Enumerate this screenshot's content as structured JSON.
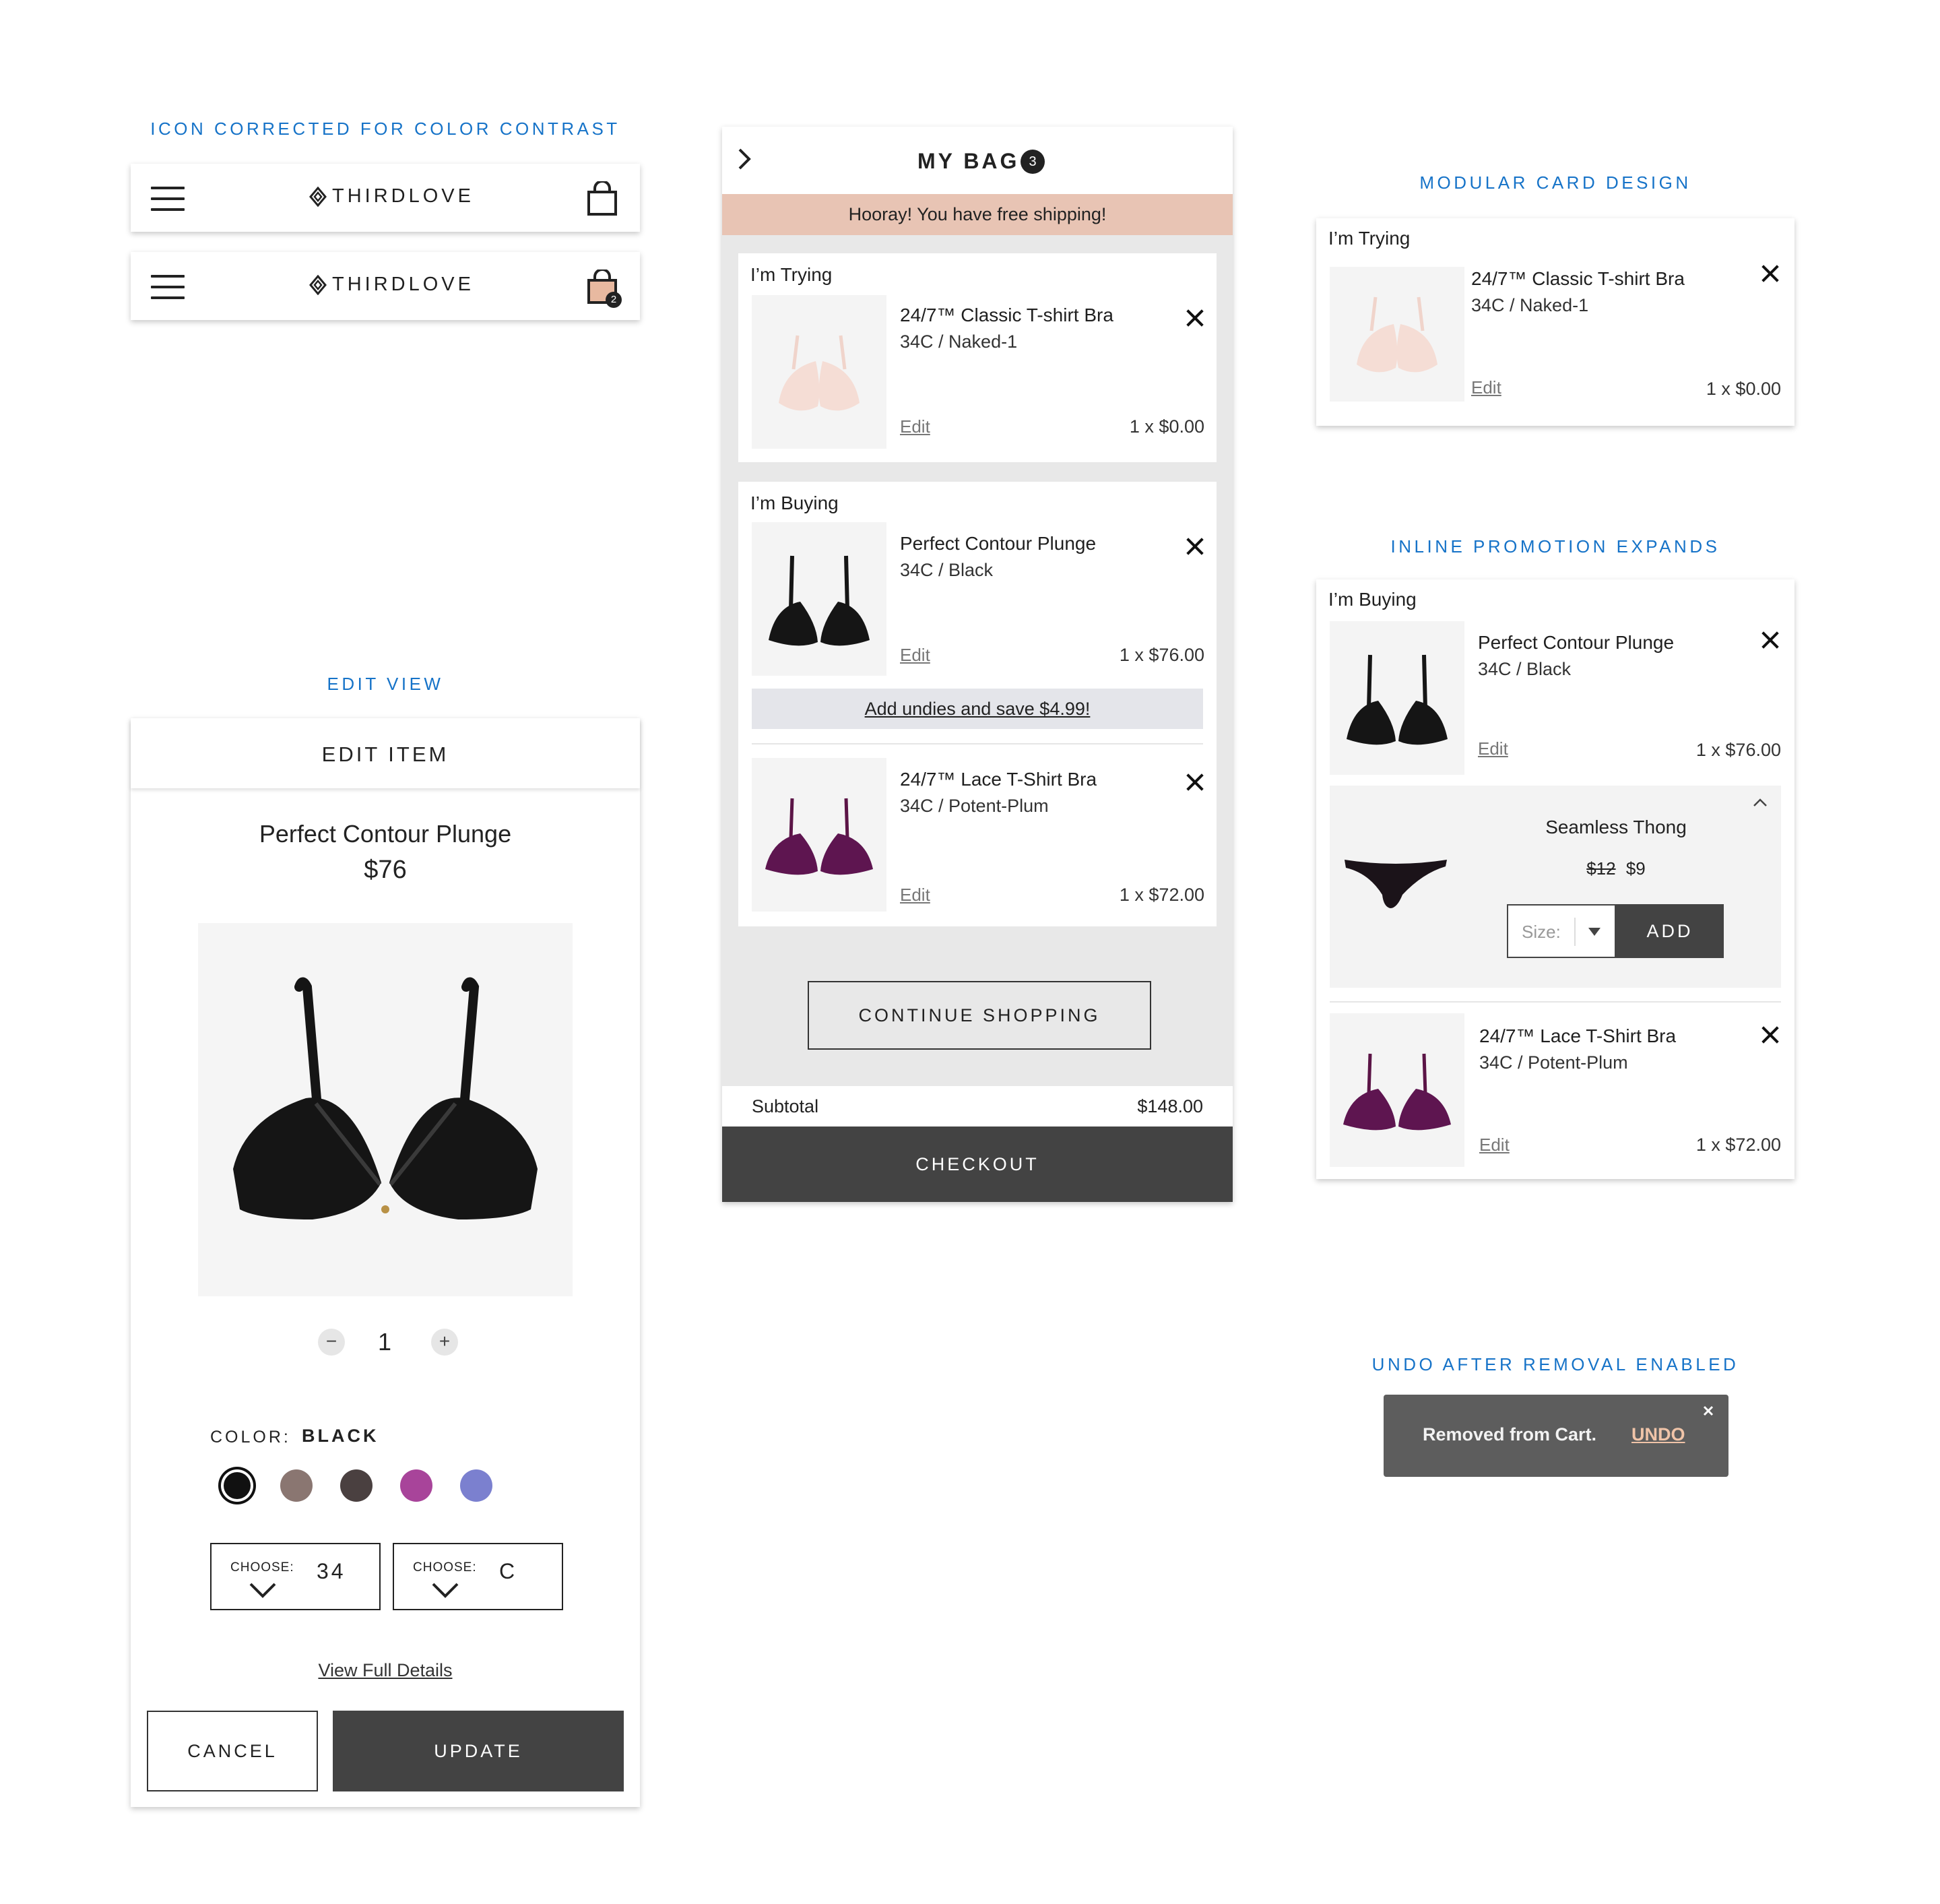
{
  "captions": {
    "icon": "ICON CORRECTED FOR COLOR CONTRAST",
    "edit": "EDIT VIEW",
    "modular": "MODULAR CARD DESIGN",
    "inline": "INLINE PROMOTION EXPANDS",
    "undo": "UNDO AFTER REMOVAL ENABLED"
  },
  "header": {
    "brand": "THIRDLOVE",
    "bag_count": "2"
  },
  "colors": {
    "accent_blue": "#1673c8",
    "promo_bar": "#e8c4b4",
    "dark_button": "#434343",
    "toast_bg": "#5d5d5d",
    "undo_link": "#f0c4a8"
  },
  "bag": {
    "title": "MY BAG",
    "count": "3",
    "promo": "Hooray! You have free shipping!",
    "trying": {
      "heading": "I’m Trying",
      "name": "24/7™ Classic T-shirt Bra",
      "variant": "34C / Naked-1",
      "edit": "Edit",
      "price": "1 x $0.00"
    },
    "buying": {
      "heading": "I’m Buying",
      "items": [
        {
          "name": "Perfect Contour Plunge",
          "variant": "34C / Black",
          "edit": "Edit",
          "price": "1 x $76.00"
        },
        {
          "name": "24/7™ Lace T-Shirt Bra",
          "variant": "34C / Potent-Plum",
          "edit": "Edit",
          "price": "1 x $72.00"
        }
      ],
      "upsell": "Add undies and save $4.99!"
    },
    "continue": "CONTINUE SHOPPING",
    "subtotal_label": "Subtotal",
    "subtotal_value": "$148.00",
    "checkout": "CHECKOUT"
  },
  "edit": {
    "title": "EDIT ITEM",
    "product": "Perfect Contour Plunge",
    "price": "$76",
    "quantity": "1",
    "qty_minus": "−",
    "qty_plus": "+",
    "color_label": "COLOR:",
    "color_value": "BLACK",
    "swatches": [
      "#111111",
      "#8a7671",
      "#4a4040",
      "#a8449a",
      "#7b80cf"
    ],
    "band_label": "CHOOSE:",
    "band_value": "34",
    "cup_label": "CHOOSE:",
    "cup_value": "C",
    "details_link": "View Full Details",
    "cancel": "CANCEL",
    "update": "UPDATE"
  },
  "modular": {
    "heading": "I’m Trying",
    "name": "24/7™ Classic T-shirt Bra",
    "variant": "34C / Naked-1",
    "edit": "Edit",
    "price": "1 x $0.00"
  },
  "inline": {
    "heading": "I’m Buying",
    "item1": {
      "name": "Perfect Contour Plunge",
      "variant": "34C / Black",
      "edit": "Edit",
      "price": "1 x $76.00"
    },
    "promo": {
      "name": "Seamless Thong",
      "old_price": "$12",
      "new_price": "$9",
      "size_placeholder": "Size:",
      "add": "ADD"
    },
    "item2": {
      "name": "24/7™ Lace T-Shirt Bra",
      "variant": "34C / Potent-Plum",
      "edit": "Edit",
      "price": "1 x $72.00"
    }
  },
  "toast": {
    "message": "Removed from Cart.",
    "undo": "UNDO"
  }
}
